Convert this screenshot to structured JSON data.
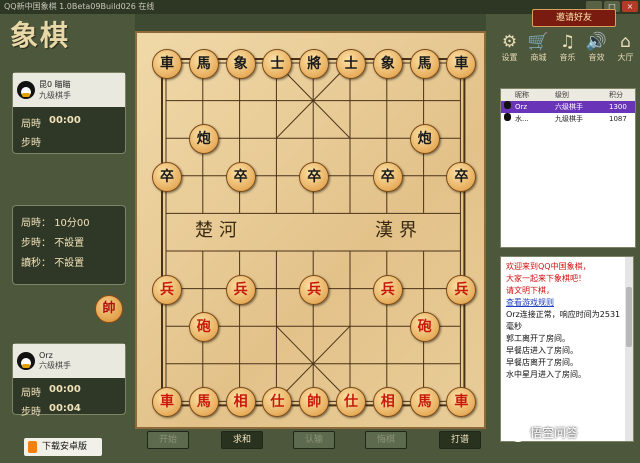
{
  "window": {
    "title": "QQ新中国象棋 1.0Beta09Build026 在线",
    "buttons": [
      "_",
      "□",
      "×"
    ]
  },
  "invite_button": "邀请好友",
  "logo": "象棋",
  "toolbar": [
    {
      "label": "设置",
      "icon": "gear-icon",
      "glyph": "⚙"
    },
    {
      "label": "商城",
      "icon": "cart-icon",
      "glyph": "🛒"
    },
    {
      "label": "音乐",
      "icon": "music-icon",
      "glyph": "♫"
    },
    {
      "label": "音效",
      "icon": "speaker-icon",
      "glyph": "🔊"
    },
    {
      "label": "大厅",
      "icon": "home-icon",
      "glyph": "⌂"
    }
  ],
  "opponent": {
    "name": "昆0 瞄瞄",
    "rank": "九级棋手",
    "game_time_label": "局時",
    "game_time": "00:00",
    "step_time_label": "步時",
    "step_time": "00:00"
  },
  "settings": {
    "game_time_label": "局時",
    "game_time": "10分00",
    "step_time_label": "步時",
    "step_time": "不設置",
    "countdown_label": "讀秒",
    "countdown": "不設置"
  },
  "side_piece": "帥",
  "player": {
    "name": "Orz",
    "rank": "六级棋手",
    "game_time_label": "局時",
    "game_time": "00:00",
    "step_time_label": "步時",
    "step_time": "00:04"
  },
  "android_button": "下载安卓版",
  "board": {
    "river_left": "楚河",
    "river_right": "漢界",
    "pieces": [
      {
        "t": "車",
        "c": "black",
        "col": 0,
        "row": 0
      },
      {
        "t": "馬",
        "c": "black",
        "col": 1,
        "row": 0
      },
      {
        "t": "象",
        "c": "black",
        "col": 2,
        "row": 0
      },
      {
        "t": "士",
        "c": "black",
        "col": 3,
        "row": 0
      },
      {
        "t": "將",
        "c": "black",
        "col": 4,
        "row": 0
      },
      {
        "t": "士",
        "c": "black",
        "col": 5,
        "row": 0
      },
      {
        "t": "象",
        "c": "black",
        "col": 6,
        "row": 0
      },
      {
        "t": "馬",
        "c": "black",
        "col": 7,
        "row": 0
      },
      {
        "t": "車",
        "c": "black",
        "col": 8,
        "row": 0
      },
      {
        "t": "炮",
        "c": "black",
        "col": 1,
        "row": 2
      },
      {
        "t": "炮",
        "c": "black",
        "col": 7,
        "row": 2
      },
      {
        "t": "卒",
        "c": "black",
        "col": 0,
        "row": 3
      },
      {
        "t": "卒",
        "c": "black",
        "col": 2,
        "row": 3
      },
      {
        "t": "卒",
        "c": "black",
        "col": 4,
        "row": 3
      },
      {
        "t": "卒",
        "c": "black",
        "col": 6,
        "row": 3
      },
      {
        "t": "卒",
        "c": "black",
        "col": 8,
        "row": 3
      },
      {
        "t": "兵",
        "c": "red",
        "col": 0,
        "row": 6
      },
      {
        "t": "兵",
        "c": "red",
        "col": 2,
        "row": 6
      },
      {
        "t": "兵",
        "c": "red",
        "col": 4,
        "row": 6
      },
      {
        "t": "兵",
        "c": "red",
        "col": 6,
        "row": 6
      },
      {
        "t": "兵",
        "c": "red",
        "col": 8,
        "row": 6
      },
      {
        "t": "砲",
        "c": "red",
        "col": 1,
        "row": 7
      },
      {
        "t": "砲",
        "c": "red",
        "col": 7,
        "row": 7
      },
      {
        "t": "車",
        "c": "red",
        "col": 0,
        "row": 9
      },
      {
        "t": "馬",
        "c": "red",
        "col": 1,
        "row": 9
      },
      {
        "t": "相",
        "c": "red",
        "col": 2,
        "row": 9
      },
      {
        "t": "仕",
        "c": "red",
        "col": 3,
        "row": 9
      },
      {
        "t": "帥",
        "c": "red",
        "col": 4,
        "row": 9
      },
      {
        "t": "仕",
        "c": "red",
        "col": 5,
        "row": 9
      },
      {
        "t": "相",
        "c": "red",
        "col": 6,
        "row": 9
      },
      {
        "t": "馬",
        "c": "red",
        "col": 7,
        "row": 9
      },
      {
        "t": "車",
        "c": "red",
        "col": 8,
        "row": 9
      }
    ]
  },
  "actions": [
    {
      "label": "开始",
      "state": "dim"
    },
    {
      "label": "求和",
      "state": "on"
    },
    {
      "label": "认输",
      "state": "dim"
    },
    {
      "label": "悔棋",
      "state": "dim"
    },
    {
      "label": "打谱",
      "state": "on"
    }
  ],
  "seat_list": {
    "headers": [
      "",
      "昵称",
      "级别",
      "积分"
    ],
    "rows": [
      {
        "name": "Orz",
        "rank": "六级棋手",
        "score": "1300",
        "selected": true
      },
      {
        "name": "水...",
        "rank": "九级棋手",
        "score": "1087",
        "selected": false
      }
    ]
  },
  "chat": [
    {
      "style": "red",
      "text": "欢迎来到QQ中国象棋，"
    },
    {
      "style": "red",
      "text": "大家一起来下象棋吧！"
    },
    {
      "style": "red",
      "text": "请文明下棋，"
    },
    {
      "style": "blue",
      "text": "查看游戏规则"
    },
    {
      "style": "norm",
      "text": "Orz连接正常，响应时间为2531毫秒"
    },
    {
      "style": "norm",
      "text": "郭工离开了房间。"
    },
    {
      "style": "norm",
      "text": "早餐店进入了房间。"
    },
    {
      "style": "norm",
      "text": "早餐店离开了房间。"
    },
    {
      "style": "norm",
      "text": "水中星月进入了房间。"
    }
  ],
  "watermark": "悟空问答"
}
